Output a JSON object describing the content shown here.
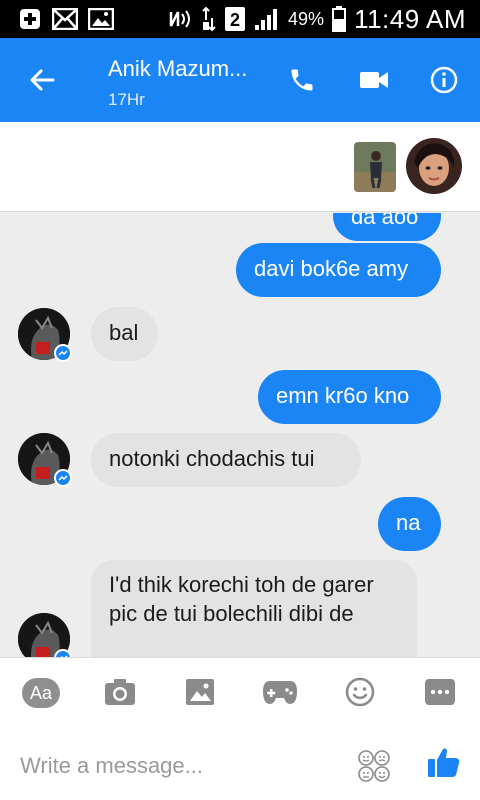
{
  "status_bar": {
    "signal_label": "2",
    "battery": "49%",
    "time": "11:49 AM",
    "icons": [
      "plus-square-icon",
      "mail-icon",
      "image-icon",
      "nfc-icon",
      "data-transfer-icon",
      "signal-icon",
      "battery-icon"
    ]
  },
  "header": {
    "contact_name": "Anik Mazum...",
    "status": "17Hr",
    "icons": [
      "back-arrow-icon",
      "phone-icon",
      "video-camera-icon",
      "info-icon"
    ]
  },
  "messages": [
    {
      "direction": "sent",
      "text": "da aoo"
    },
    {
      "direction": "sent",
      "text": "davi bok6e amy"
    },
    {
      "direction": "received",
      "text": "bal"
    },
    {
      "direction": "sent",
      "text": "emn kr6o kno"
    },
    {
      "direction": "received",
      "text": "notonki chodachis tui"
    },
    {
      "direction": "sent",
      "text": "na"
    },
    {
      "direction": "received",
      "text": "I'd thik korechi toh de garer pic de tui bolechili dibi de"
    }
  ],
  "composer": {
    "aa_label": "Aa",
    "placeholder": "Write a message...",
    "icons": [
      "camera-icon",
      "gallery-icon",
      "gamepad-icon",
      "emoji-icon",
      "more-icon",
      "sticker-icon",
      "thumbs-up-icon"
    ]
  },
  "colors": {
    "accent": "#1c85f5",
    "received_bubble": "#e3e3e3",
    "background": "#ededed"
  }
}
